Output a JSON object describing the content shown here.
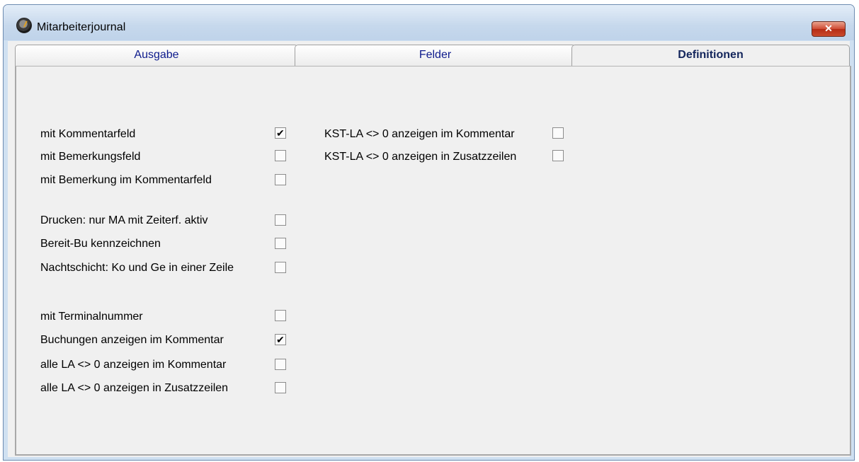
{
  "window": {
    "title": "Mitarbeiterjournal",
    "close_label": "✕"
  },
  "tabs": [
    {
      "label": "Ausgabe",
      "active": false
    },
    {
      "label": "Felder",
      "active": false
    },
    {
      "label": "Definitionen",
      "active": true
    }
  ],
  "options_left": [
    {
      "label": "mit Kommentarfeld",
      "checked": true
    },
    {
      "label": "mit Bemerkungsfeld",
      "checked": false
    },
    {
      "label": "mit Bemerkung im Kommentarfeld",
      "checked": false
    },
    {
      "label": "Drucken: nur MA mit Zeiterf. aktiv",
      "checked": false
    },
    {
      "label": "Bereit-Bu kennzeichnen",
      "checked": false
    },
    {
      "label": "Nachtschicht: Ko und Ge in einer Zeile",
      "checked": false
    },
    {
      "label": "mit Terminalnummer",
      "checked": false
    },
    {
      "label": "Buchungen anzeigen im Kommentar",
      "checked": true
    },
    {
      "label": "alle LA <> 0 anzeigen im Kommentar",
      "checked": false
    },
    {
      "label": "alle LA <> 0 anzeigen in Zusatzzeilen",
      "checked": false
    }
  ],
  "options_right": [
    {
      "label": "KST-LA <> 0 anzeigen im Kommentar",
      "checked": false
    },
    {
      "label": "KST-LA <> 0 anzeigen in Zusatzzeilen",
      "checked": false
    }
  ]
}
